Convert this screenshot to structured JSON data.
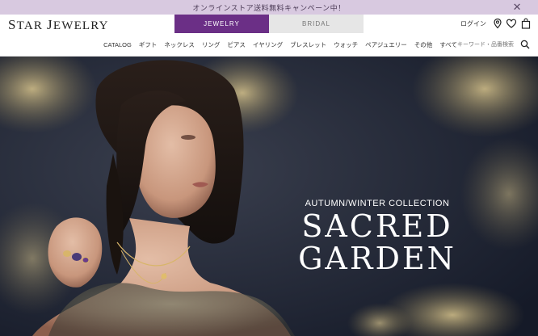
{
  "promo": {
    "text": "オンラインストア送料無料キャンペーン中！",
    "close_icon": "close-icon"
  },
  "header": {
    "logo": "Star Jewelry",
    "tabs": [
      {
        "label": "JEWELRY",
        "active": true
      },
      {
        "label": "BRIDAL",
        "active": false
      }
    ],
    "login_label": "ログイン",
    "icons": [
      "location-pin-icon",
      "heart-icon",
      "shopping-bag-icon"
    ]
  },
  "nav": {
    "items": [
      "CATALOG",
      "ギフト",
      "ネックレス",
      "リング",
      "ピアス",
      "イヤリング",
      "ブレスレット",
      "ウォッチ",
      "ペアジュエリー",
      "その他",
      "すべて"
    ],
    "search_placeholder": "キーワード・品番検索"
  },
  "hero": {
    "subtitle": "AUTUMN/WINTER COLLECTION",
    "title_line1": "SACRED",
    "title_line2": "GARDEN"
  },
  "colors": {
    "brand": "#6b2f86",
    "promo_bg": "#d8c9e0",
    "bridal_tab": "#e6e6e6"
  }
}
